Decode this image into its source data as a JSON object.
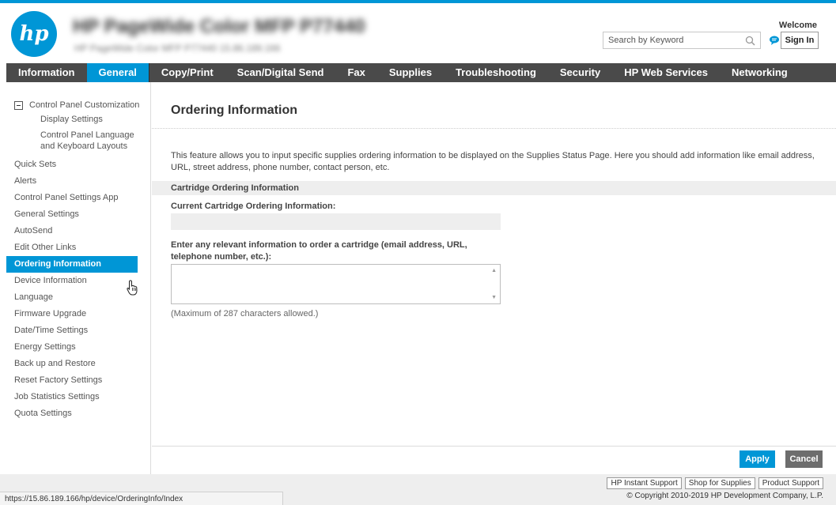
{
  "header": {
    "logo_text": "hp",
    "product_name": "HP PageWide Color MFP P77440",
    "product_sub": "HP PageWide Color MFP P77440   15.86.189.166",
    "search_placeholder": "Search by Keyword",
    "welcome": "Welcome",
    "signin": "Sign In"
  },
  "nav": [
    {
      "label": "Information"
    },
    {
      "label": "General"
    },
    {
      "label": "Copy/Print"
    },
    {
      "label": "Scan/Digital Send"
    },
    {
      "label": "Fax"
    },
    {
      "label": "Supplies"
    },
    {
      "label": "Troubleshooting"
    },
    {
      "label": "Security"
    },
    {
      "label": "HP Web Services"
    },
    {
      "label": "Networking"
    }
  ],
  "sidebar": {
    "group_label": "Control Panel Customization",
    "sub_items": [
      "Display Settings",
      "Control Panel Language and Keyboard Layouts"
    ],
    "items": [
      "Quick Sets",
      "Alerts",
      "Control Panel Settings App",
      "General Settings",
      "AutoSend",
      "Edit Other Links",
      "Ordering Information",
      "Device Information",
      "Language",
      "Firmware Upgrade",
      "Date/Time Settings",
      "Energy Settings",
      "Back up and Restore",
      "Reset Factory Settings",
      "Job Statistics Settings",
      "Quota Settings"
    ]
  },
  "main": {
    "title": "Ordering Information",
    "description": "This feature allows you to input specific supplies ordering information to be displayed on the Supplies Status Page. Here you should add information like email address, URL, street address, phone number, contact person, etc.",
    "section_title": "Cartridge Ordering Information",
    "current_label": "Current Cartridge Ordering Information:",
    "current_value": "",
    "enter_label": "Enter any relevant information to order a cartridge (email address, URL, telephone number, etc.):",
    "enter_value": "",
    "hint": "(Maximum of 287 characters allowed.)",
    "apply_label": "Apply",
    "cancel_label": "Cancel"
  },
  "footer": {
    "links": [
      "HP Instant Support",
      "Shop for Supplies",
      "Product Support"
    ],
    "copyright": "© Copyright 2010-2019 HP Development Company, L.P."
  },
  "status_url": "https://15.86.189.166/hp/device/OrderingInfo/Index",
  "colors": {
    "accent": "#0096d6",
    "nav_bg": "#4a4a4a",
    "cancel_bg": "#6d6d6d"
  }
}
